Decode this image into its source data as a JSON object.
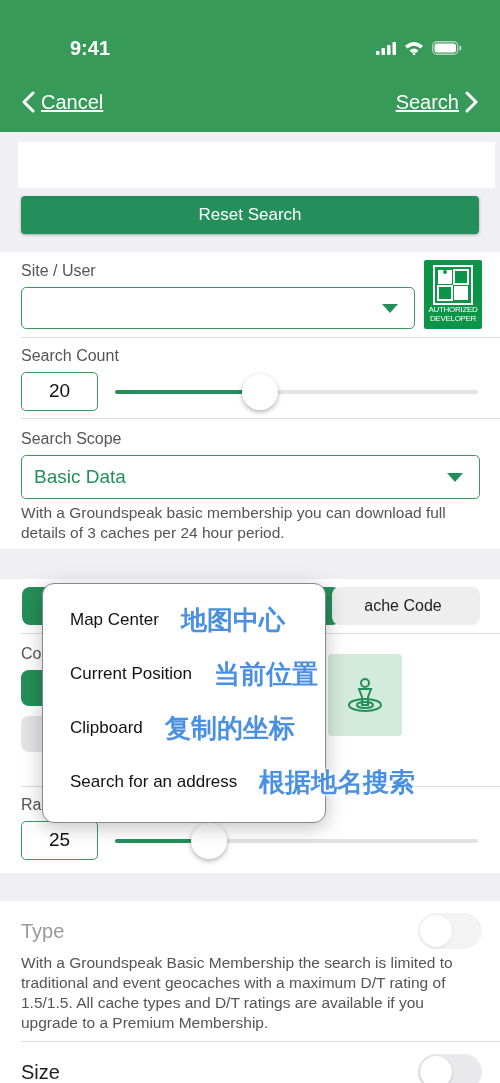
{
  "status_bar": {
    "time": "9:41"
  },
  "nav": {
    "back": "Cancel",
    "forward": "Search"
  },
  "reset_button": "Reset Search",
  "site_user": {
    "label": "Site / User",
    "logo_text": "AUTHORIZED DEVELOPER"
  },
  "search_count": {
    "label": "Search Count",
    "value": "20",
    "level": 0.4
  },
  "search_scope": {
    "label": "Search Scope",
    "value": "Basic Data",
    "note": "With a Groundspeak basic membership you can download full details of 3 caches per 24 hour period."
  },
  "segments": [
    {
      "selected": true
    },
    {
      "label": "ache Code",
      "selected": false
    }
  ],
  "coordinates": {
    "label": "Co",
    "buttons": [
      {
        "selected": true
      },
      {
        "selected": false
      }
    ]
  },
  "radius": {
    "label": "Ra",
    "value": "25",
    "level": 0.26
  },
  "menu": {
    "items": [
      {
        "label": "Map Center",
        "annotation": "地图中心"
      },
      {
        "label": "Current Position",
        "annotation": "当前位置"
      },
      {
        "label": "Clipboard",
        "annotation": "复制的坐标"
      },
      {
        "label": "Search for an address",
        "annotation": "根据地名搜索"
      }
    ]
  },
  "toggles": [
    {
      "label": "Type",
      "on": false,
      "disabled": true,
      "note": "With a Groundspeak Basic Membership the search is limited to traditional and event geocaches with a maximum D/T rating of 1.5/1.5. All cache types and D/T ratings are available if you upgrade to a Premium Membership."
    },
    {
      "label": "Size",
      "on": false,
      "disabled": false
    }
  ]
}
